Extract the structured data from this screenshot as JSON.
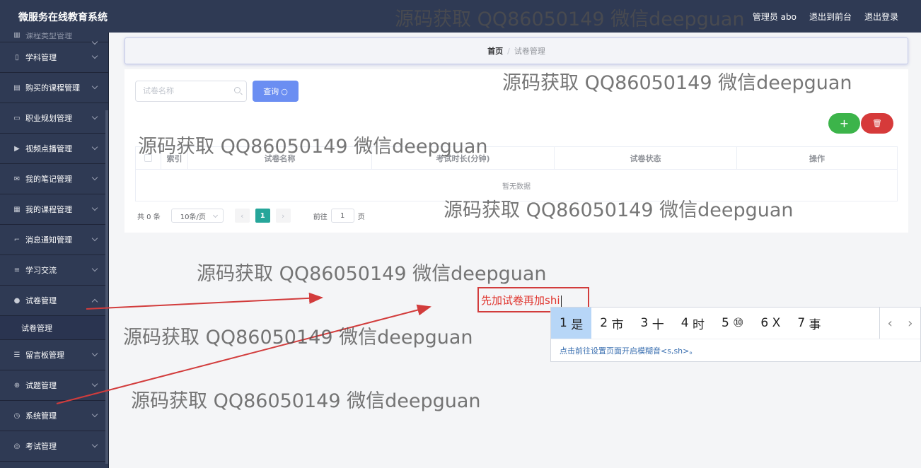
{
  "header": {
    "title": "微服务在线教育系统",
    "user": "管理员 abo",
    "back_to_front": "退出到前台",
    "logout": "退出登录"
  },
  "sidebar": {
    "partial_item": "课程类型管理",
    "items": [
      {
        "label": "学科管理",
        "icon": "subject-icon"
      },
      {
        "label": "购买的课程管理",
        "icon": "clipboard-icon"
      },
      {
        "label": "职业规划管理",
        "icon": "monitor-icon"
      },
      {
        "label": "视频点播管理",
        "icon": "video-icon"
      },
      {
        "label": "我的笔记管理",
        "icon": "mail-icon"
      },
      {
        "label": "我的课程管理",
        "icon": "grid-icon"
      },
      {
        "label": "消息通知管理",
        "icon": "crop-icon"
      },
      {
        "label": "学习交流",
        "icon": "sliders-icon"
      },
      {
        "label": "试卷管理",
        "icon": "user-icon"
      }
    ],
    "sub_item": "试卷管理",
    "items_after": [
      {
        "label": "留言板管理",
        "icon": "list-icon"
      },
      {
        "label": "试题管理",
        "icon": "target-icon"
      },
      {
        "label": "系统管理",
        "icon": "clock-icon"
      },
      {
        "label": "考试管理",
        "icon": "compass-icon"
      }
    ]
  },
  "breadcrumb": {
    "home": "首页",
    "separator": "/",
    "current": "试卷管理"
  },
  "search": {
    "placeholder": "试卷名称",
    "query_label": "查询"
  },
  "actions": {
    "add": "+",
    "delete": "🗑"
  },
  "table": {
    "columns": [
      "索引",
      "试卷名称",
      "考试时长(分钟)",
      "试卷状态",
      "操作"
    ],
    "empty_text": "暂无数据"
  },
  "pagination": {
    "total": "共 0 条",
    "page_size": "10条/页",
    "prev": "‹",
    "current": "1",
    "next": "›",
    "goto_label": "前往",
    "goto_value": "1",
    "page_suffix": "页"
  },
  "watermark": "源码获取 QQ86050149 微信deepguan",
  "annotation": {
    "text": "先加试卷再加shi"
  },
  "ime": {
    "candidates": [
      {
        "num": "1",
        "text": "是"
      },
      {
        "num": "2",
        "text": "市"
      },
      {
        "num": "3",
        "text": "十"
      },
      {
        "num": "4",
        "text": "时"
      },
      {
        "num": "5",
        "text": "⑩"
      },
      {
        "num": "6",
        "text": "X"
      },
      {
        "num": "7",
        "text": "事"
      }
    ],
    "prev": "‹",
    "next": "›",
    "hint": "点击前往设置页面开启模糊音<s,sh>。"
  },
  "colors": {
    "sidebar_bg": "#2f3a54",
    "primary": "#6b8ef2",
    "success": "#3cb44a",
    "danger": "#d63a3a",
    "active_page": "#26a69a",
    "annotation": "#d23c3c"
  }
}
